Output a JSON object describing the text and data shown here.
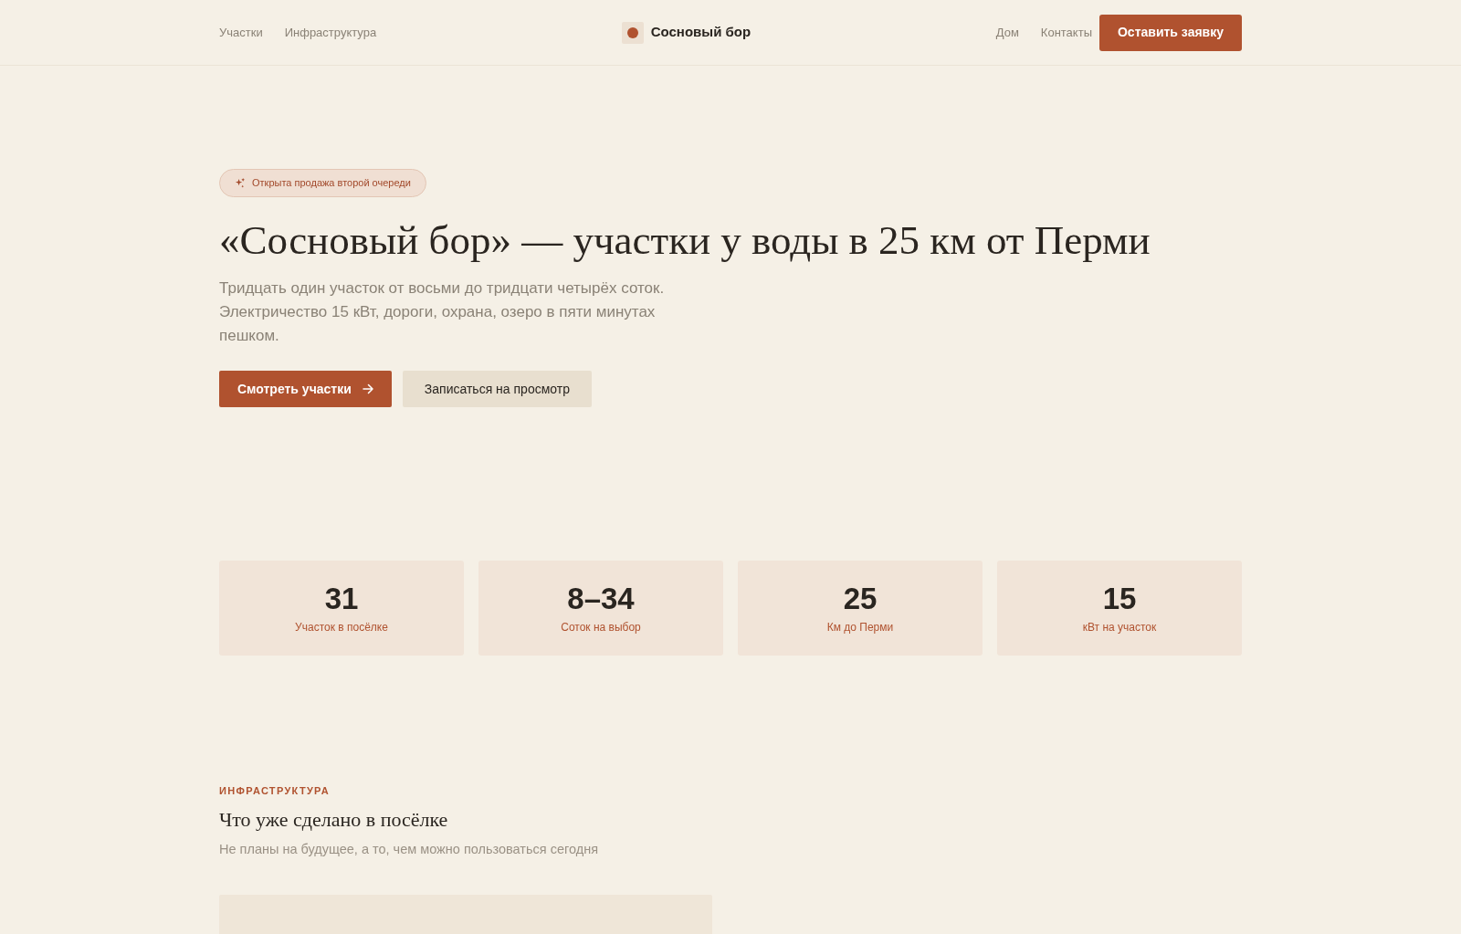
{
  "header": {
    "nav_left": [
      {
        "label": "Участки"
      },
      {
        "label": "Инфраструктура"
      }
    ],
    "logo": {
      "text": "Сосновый бор"
    },
    "nav_right": [
      {
        "label": "Дом"
      },
      {
        "label": "Контакты"
      }
    ],
    "cta_button": "Оставить заявку"
  },
  "hero": {
    "badge": "Открыта продажа второй очереди",
    "title": "«Сосновый бор» — участки у воды в 25 км от Перми",
    "description": "Тридцать один участок от восьми до тридцати четырёх соток. Электричество 15 кВт, дороги, охрана, озеро в пяти минутах пешком.",
    "primary_button": "Смотреть участки",
    "secondary_button": "Записаться на просмотр"
  },
  "stats": [
    {
      "value": "31",
      "label": "Участок в посёлке"
    },
    {
      "value": "8–34",
      "label": "Соток на выбор"
    },
    {
      "value": "25",
      "label": "Км до Перми"
    },
    {
      "value": "15",
      "label": "кВт на участок"
    }
  ],
  "infrastructure": {
    "eyebrow": "ИНФРАСТРУКТУРА",
    "title": "Что уже сделано в посёлке",
    "subtitle": "Не планы на будущее, а то, чем можно пользоваться сегодня"
  }
}
